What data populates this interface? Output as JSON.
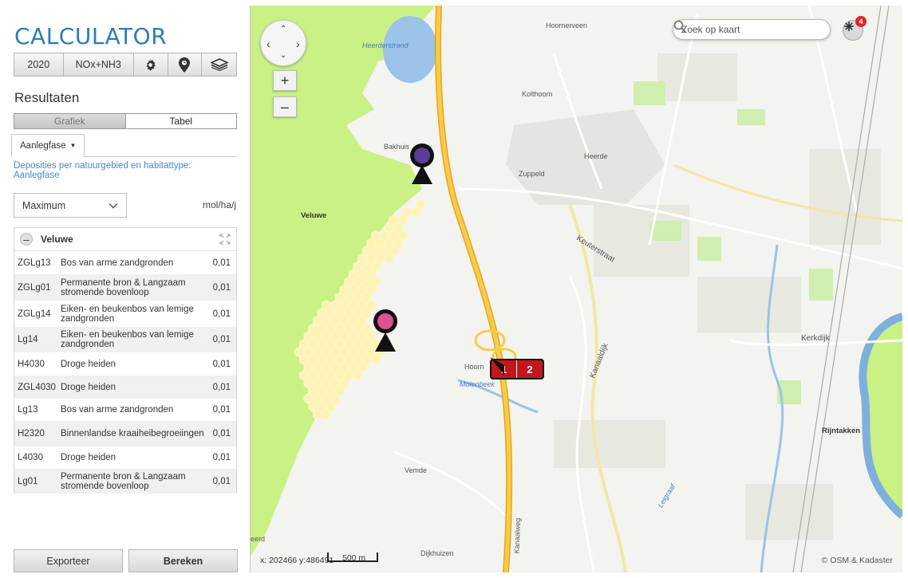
{
  "app": {
    "title": "CALCULATOR"
  },
  "toolbar": {
    "year": "2020",
    "substance": "NOx+NH3",
    "gear_icon": "gear-icon",
    "pin_icon": "location-pin-icon",
    "layers_icon": "layers-icon"
  },
  "results": {
    "title": "Resultaten",
    "view_toggle": {
      "chart": "Grafiek",
      "table": "Tabel",
      "active": "Tabel"
    },
    "tab": {
      "label": "Aanlegfase",
      "caret": "▼"
    },
    "depositions_title": "Deposities per natuurgebied en habitattype: Aanlegfase",
    "select": {
      "value": "Maximum",
      "chevron": "⌵"
    },
    "unit": "mol/ha/j",
    "group": {
      "name": "Veluwe",
      "minus": "–"
    },
    "rows": [
      {
        "code": "ZGLg13",
        "name": "Bos van arme zandgronden",
        "value": "0,01"
      },
      {
        "code": "ZGLg01",
        "name": "Permanente bron & Langzaam stromende bovenloop",
        "value": "0,01"
      },
      {
        "code": "ZGLg14",
        "name": "Eiken- en beukenbos van lemige zandgronden",
        "value": "0,01"
      },
      {
        "code": "Lg14",
        "name": "Eiken- en beukenbos van lemige zandgronden",
        "value": "0,01"
      },
      {
        "code": "H4030",
        "name": "Droge heiden",
        "value": "0,01"
      },
      {
        "code": "ZGL4030",
        "name": "Droge heiden",
        "value": "0,01"
      },
      {
        "code": "Lg13",
        "name": "Bos van arme zandgronden",
        "value": "0,01"
      },
      {
        "code": "H2320",
        "name": "Binnenlandse kraaiheibegroeiingen",
        "value": "0,01"
      },
      {
        "code": "L4030",
        "name": "Droge heiden",
        "value": "0,01"
      },
      {
        "code": "Lg01",
        "name": "Permanente bron & Langzaam stromende bovenloop",
        "value": "0,01"
      }
    ],
    "export_label": "Exporteer",
    "calculate_label": "Bereken"
  },
  "map": {
    "search_placeholder": "Zoek op kaart",
    "notification_count": "4",
    "zoom_in": "+",
    "zoom_out": "–",
    "nav": {
      "up": "⌃",
      "down": "⌄",
      "left": "‹",
      "right": "›"
    },
    "source_marker": [
      "1",
      "2"
    ],
    "coordinates": "x: 202466 y:486491",
    "scale": "500 m",
    "attribution": "© OSM & Kadaster",
    "labels": {
      "heerderstrand": "Heerderstrand",
      "hoornerveen": "Hoornerveen",
      "kolthoorn": "Kolthoorn",
      "bakhuis": "Bakhuis",
      "heerde": "Heerde",
      "zuppeld": "Zuppeld",
      "veluwe": "Veluwe",
      "keuterstraat": "Keuterstraat",
      "kanaaldijk": "Kanaaldijk",
      "kerkdijk": "Kerkdijk",
      "hoorn": "Hoorn",
      "molenbeek": "Molenbeek",
      "rijntakken": "Rijntakken",
      "vemde": "Vemde",
      "dijkhuizen": "Dijkhuizen",
      "kanaalweg": "Kanaalweg",
      "leigraaf": "Leigraaf",
      "eerd": "eerd"
    },
    "colors": {
      "nature": "#c9f184",
      "highway": "#f5c244",
      "water": "#9cc3e8",
      "hexagons": "#fbf4b6",
      "marker_purple": "#5a3e95",
      "marker_pink": "#e0528f"
    }
  }
}
